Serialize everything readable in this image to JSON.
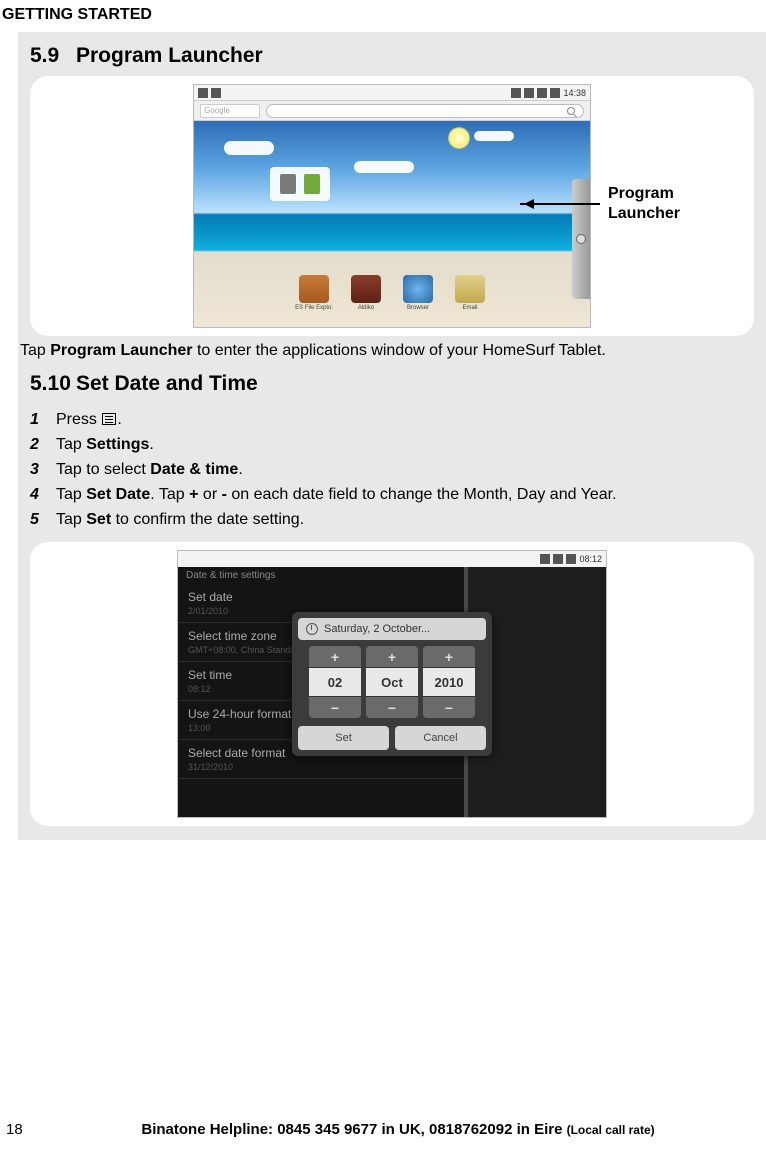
{
  "header": {
    "title": "GETTING STARTED"
  },
  "section59": {
    "number": "5.9",
    "title": "Program Launcher",
    "callout": {
      "line1": "Program",
      "line2": "Launcher"
    },
    "body_prefix": "Tap ",
    "body_bold": "Program Launcher",
    "body_suffix": " to enter the applications window of your HomeSurf Tablet.",
    "screenshot": {
      "time": "14:38",
      "searchPlaceholder": "Google",
      "dock": [
        {
          "label": "ES File Explo:"
        },
        {
          "label": "Aldiko"
        },
        {
          "label": "Browser"
        },
        {
          "label": "Email"
        }
      ]
    }
  },
  "section510": {
    "number": "5.10",
    "title": "Set Date and Time",
    "steps": [
      {
        "n": "1",
        "pre": "Press ",
        "icon": true,
        "post": "."
      },
      {
        "n": "2",
        "pre": "Tap ",
        "b1": "Settings",
        "post": "."
      },
      {
        "n": "3",
        "pre": "Tap to select ",
        "b1": "Date & time",
        "post": "."
      },
      {
        "n": "4",
        "pre": "Tap ",
        "b1": "Set Date",
        "mid": ". Tap ",
        "b2": "+",
        "mid2": " or ",
        "b3": "-",
        "post": " on each date field to change the Month, Day and Year."
      },
      {
        "n": "5",
        "pre": "Tap ",
        "b1": "Set",
        "post": " to confirm the date setting."
      }
    ],
    "screenshot": {
      "time": "08:12",
      "menuTitle": "Date & time settings",
      "rows": [
        {
          "t": "Set date",
          "s": "2/01/2010"
        },
        {
          "t": "Select time zone",
          "s": "GMT+08:00, China Standard Time"
        },
        {
          "t": "Set time",
          "s": "08:12"
        },
        {
          "t": "Use 24-hour format",
          "s": "13:00"
        },
        {
          "t": "Select date format",
          "s": "31/12/2010"
        }
      ],
      "dialog": {
        "title": "Saturday, 2 October...",
        "day": "02",
        "month": "Oct",
        "year": "2010",
        "set": "Set",
        "cancel": "Cancel"
      }
    }
  },
  "footer": {
    "page": "18",
    "text": "Binatone Helpline: 0845 345 9677 in UK, 0818762092 in Eire ",
    "small": "(Local call rate)"
  }
}
